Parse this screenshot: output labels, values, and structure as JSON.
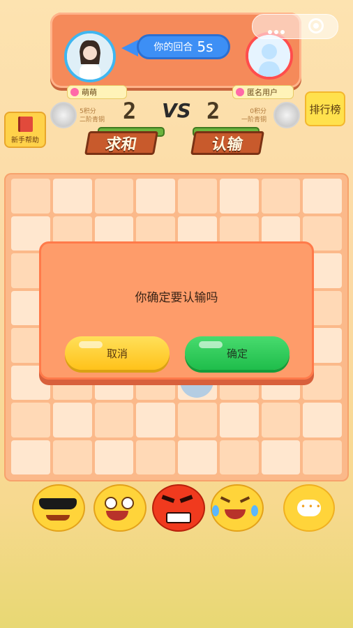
{
  "turn": {
    "label": "你的回合",
    "seconds": "5s"
  },
  "players": {
    "left": {
      "name": "萌萌",
      "score": "2",
      "points": "5积分",
      "rank": "二阶青铜"
    },
    "right": {
      "name": "匿名用户",
      "score": "2",
      "points": "0积分",
      "rank": "一阶青铜"
    }
  },
  "vs": "VS",
  "buttons": {
    "draw": "求和",
    "surrender": "认输",
    "help": "新手帮助",
    "leaderboard": "排行榜"
  },
  "dialog": {
    "message": "你确定要认输吗",
    "cancel": "取消",
    "confirm": "确定"
  },
  "emojis": [
    "cool-sunglasses",
    "laughing",
    "angry",
    "crying"
  ],
  "colors": {
    "panel": "#f58a5a",
    "turn_pill": "#3d8ff5",
    "cancel_button": "#ffc21a",
    "confirm_button": "#1fbd4b"
  }
}
